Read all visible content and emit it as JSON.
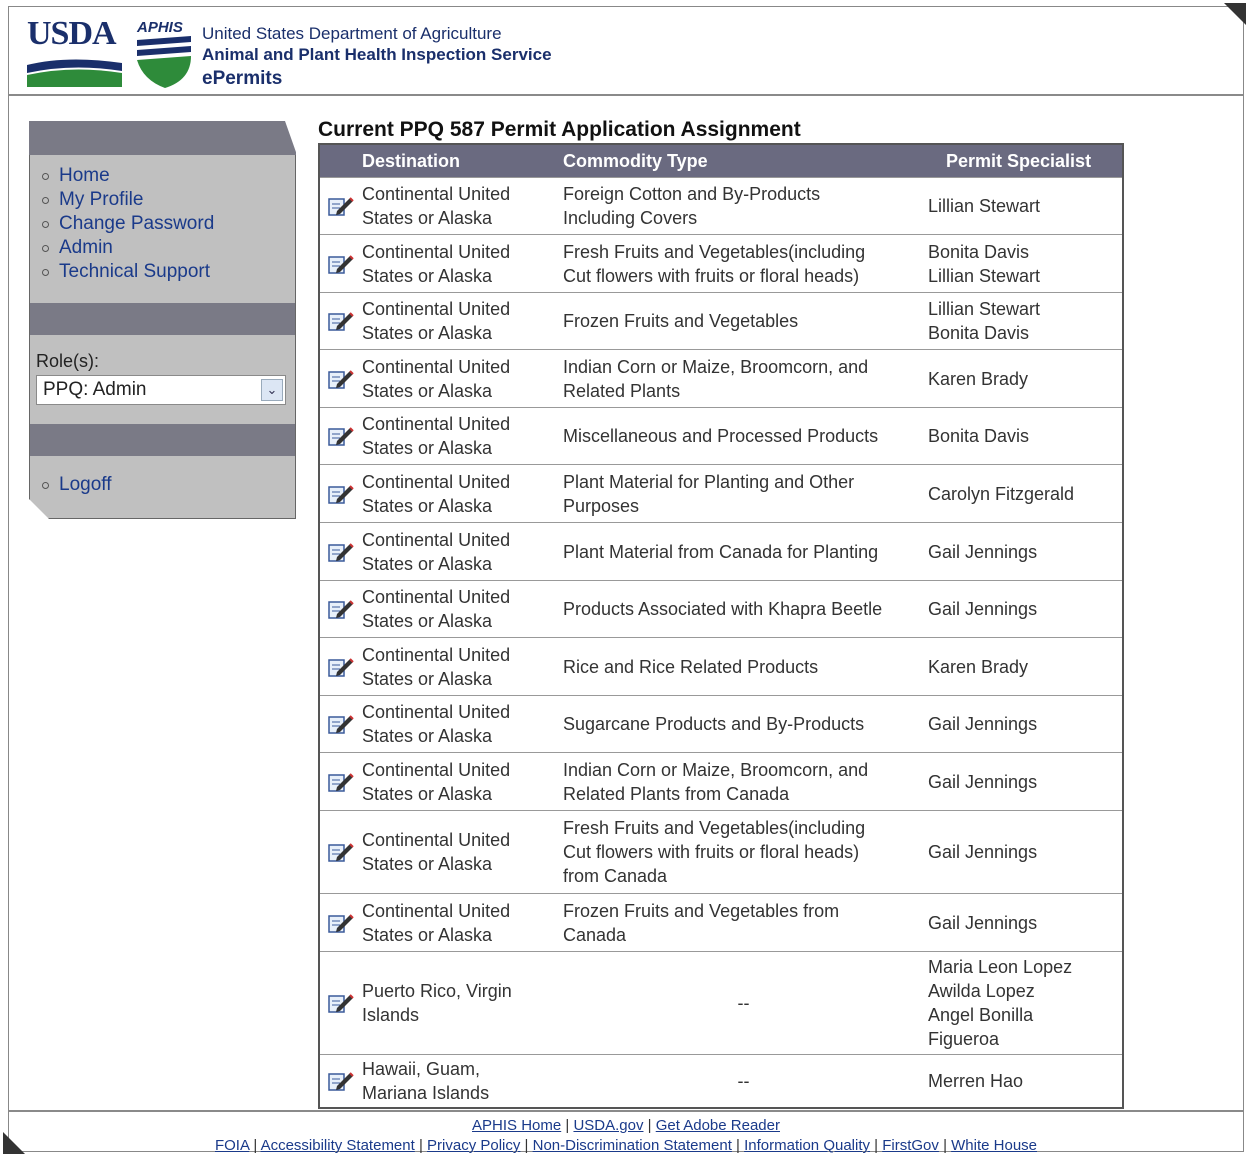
{
  "header": {
    "usda_text": "USDA",
    "aphis_text": "APHIS",
    "org_line1": "United States Department of Agriculture",
    "org_line2": "Animal and Plant Health Inspection Service",
    "org_line3": "ePermits"
  },
  "sidebar": {
    "nav": [
      "Home",
      "My Profile",
      "Change Password",
      "Admin",
      "Technical Support"
    ],
    "role_label": "Role(s):",
    "role_value": "PPQ: Admin",
    "logoff": "Logoff"
  },
  "main": {
    "title": "Current PPQ 587 Permit Application Assignment",
    "columns": [
      "Destination",
      "Commodity Type",
      "Permit Specialist"
    ],
    "rows": [
      {
        "destination": "Continental United\nStates or Alaska",
        "commodity": "Foreign Cotton and By-Products\nIncluding Covers",
        "specialist": "Lillian Stewart"
      },
      {
        "destination": "Continental United\nStates or Alaska",
        "commodity": "Fresh Fruits and Vegetables(including\nCut flowers with fruits or floral heads)",
        "specialist": "Bonita Davis\nLillian Stewart"
      },
      {
        "destination": "Continental United\nStates or Alaska",
        "commodity": "Frozen Fruits and Vegetables",
        "specialist": "Lillian Stewart\nBonita Davis"
      },
      {
        "destination": "Continental United\nStates or Alaska",
        "commodity": "Indian Corn or Maize, Broomcorn, and\nRelated Plants",
        "specialist": "Karen Brady"
      },
      {
        "destination": "Continental United\nStates or Alaska",
        "commodity": "Miscellaneous and Processed Products",
        "specialist": "Bonita Davis"
      },
      {
        "destination": "Continental United\nStates or Alaska",
        "commodity": "Plant Material for Planting and Other\nPurposes",
        "specialist": "Carolyn Fitzgerald"
      },
      {
        "destination": "Continental United\nStates or Alaska",
        "commodity": "Plant Material from Canada for Planting",
        "specialist": "Gail Jennings"
      },
      {
        "destination": "Continental United\nStates or Alaska",
        "commodity": "Products Associated with Khapra Beetle",
        "specialist": "Gail Jennings"
      },
      {
        "destination": "Continental United\nStates or Alaska",
        "commodity": "Rice and Rice Related Products",
        "specialist": "Karen Brady"
      },
      {
        "destination": "Continental United\nStates or Alaska",
        "commodity": "Sugarcane Products and By-Products",
        "specialist": "Gail Jennings"
      },
      {
        "destination": "Continental United\nStates or Alaska",
        "commodity": "Indian Corn or Maize, Broomcorn, and\nRelated Plants from Canada",
        "specialist": "Gail Jennings"
      },
      {
        "destination": "Continental United\nStates or Alaska",
        "commodity": "Fresh Fruits and Vegetables(including\nCut flowers with fruits or floral heads)\nfrom Canada",
        "specialist": "Gail Jennings"
      },
      {
        "destination": "Continental United\nStates or Alaska",
        "commodity": "Frozen Fruits and Vegetables from\nCanada",
        "specialist": "Gail Jennings"
      },
      {
        "destination": "Puerto Rico, Virgin\nIslands",
        "commodity": "--",
        "specialist": "Maria Leon Lopez\nAwilda Lopez\nAngel Bonilla\nFigueroa"
      },
      {
        "destination": "Hawaii, Guam,\nMariana Islands",
        "commodity": "--",
        "specialist": "Merren Hao"
      }
    ]
  },
  "footer": {
    "line1": [
      "APHIS Home",
      "USDA.gov",
      "Get Adobe Reader"
    ],
    "line2": [
      "FOIA",
      "Accessibility Statement",
      "Privacy Policy",
      "Non-Discrimination Statement",
      "Information Quality",
      "FirstGov",
      "White House"
    ]
  },
  "icons": {
    "edit": "edit-pencil-icon",
    "dropdown": "chevron-down-icon"
  }
}
